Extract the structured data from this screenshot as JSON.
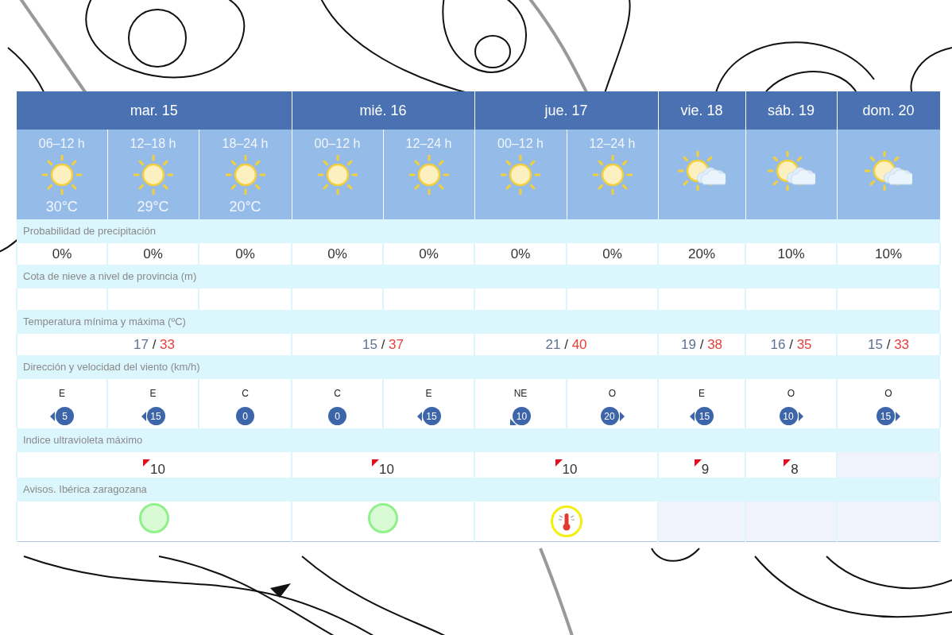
{
  "days": [
    {
      "label": "mar. 15",
      "periods": [
        {
          "time": "06–12 h",
          "kind": "sunny",
          "temp": "30°C"
        },
        {
          "time": "12–18 h",
          "kind": "sunny",
          "temp": "29°C"
        },
        {
          "time": "18–24 h",
          "kind": "sunny",
          "temp": "20°C"
        }
      ]
    },
    {
      "label": "mié. 16",
      "periods": [
        {
          "time": "00–12 h",
          "kind": "sunny"
        },
        {
          "time": "12–24 h",
          "kind": "sunny"
        }
      ]
    },
    {
      "label": "jue. 17",
      "periods": [
        {
          "time": "00–12 h",
          "kind": "sunny"
        },
        {
          "time": "12–24 h",
          "kind": "sunny"
        }
      ]
    },
    {
      "label": "vie. 18",
      "periods": [
        {
          "kind": "partly_cloudy"
        }
      ]
    },
    {
      "label": "sáb. 19",
      "periods": [
        {
          "kind": "partly_cloudy"
        }
      ]
    },
    {
      "label": "dom. 20",
      "periods": [
        {
          "kind": "partly_cloudy"
        }
      ]
    }
  ],
  "rows": [
    {
      "kind": "precip",
      "label": "Probabilidad de precipitación",
      "cells": [
        {
          "value": "0%"
        },
        {
          "value": "0%"
        },
        {
          "value": "0%"
        },
        {
          "value": "0%"
        },
        {
          "value": "0%"
        },
        {
          "value": "0%"
        },
        {
          "value": "0%"
        },
        {
          "value": "20%"
        },
        {
          "value": "10%"
        },
        {
          "value": "10%"
        }
      ]
    },
    {
      "kind": "blank",
      "label": "Cota de nieve a nivel de provincia (m)"
    },
    {
      "kind": "temp",
      "label": "Temperatura mínima y máxima (ºC)",
      "cells": [
        {
          "min": "17",
          "separator": "/",
          "max": "33"
        },
        {
          "min": "15",
          "separator": "/",
          "max": "37"
        },
        {
          "min": "21",
          "separator": "/",
          "max": "40"
        },
        {
          "min": "19",
          "separator": "/",
          "max": "38"
        },
        {
          "min": "16",
          "separator": "/",
          "max": "35"
        },
        {
          "min": "15",
          "separator": "/",
          "max": "33"
        }
      ]
    },
    {
      "kind": "wind",
      "label": "Dirección y velocidad del viento (km/h)",
      "cells": [
        {
          "dir": "E",
          "speed": "5",
          "kind": "left"
        },
        {
          "dir": "E",
          "speed": "15",
          "kind": "left"
        },
        {
          "dir": "C",
          "speed": "0",
          "kind": "calm"
        },
        {
          "dir": "C",
          "speed": "0",
          "kind": "calm"
        },
        {
          "dir": "E",
          "speed": "15",
          "kind": "left"
        },
        {
          "dir": "NE",
          "speed": "10",
          "kind": "down_left"
        },
        {
          "dir": "O",
          "speed": "20",
          "kind": "right"
        },
        {
          "dir": "E",
          "speed": "15",
          "kind": "left"
        },
        {
          "dir": "O",
          "speed": "10",
          "kind": "right"
        },
        {
          "dir": "O",
          "speed": "15",
          "kind": "right"
        }
      ]
    },
    {
      "kind": "uv",
      "label": "Indice ultravioleta máximo",
      "cells": [
        {
          "value": "10",
          "available": true
        },
        {
          "value": "10",
          "available": true
        },
        {
          "value": "10",
          "available": true
        },
        {
          "value": "9",
          "available": true
        },
        {
          "value": "8",
          "available": true
        },
        {
          "available": false
        }
      ]
    },
    {
      "kind": "warning",
      "label": "Avisos. Ibérica zaragozana",
      "cells": [
        {
          "kind": "green"
        },
        {
          "kind": "green"
        },
        {
          "kind": "heat"
        },
        {
          "kind": "none"
        },
        {
          "kind": "none"
        },
        {
          "kind": "none"
        }
      ]
    }
  ]
}
